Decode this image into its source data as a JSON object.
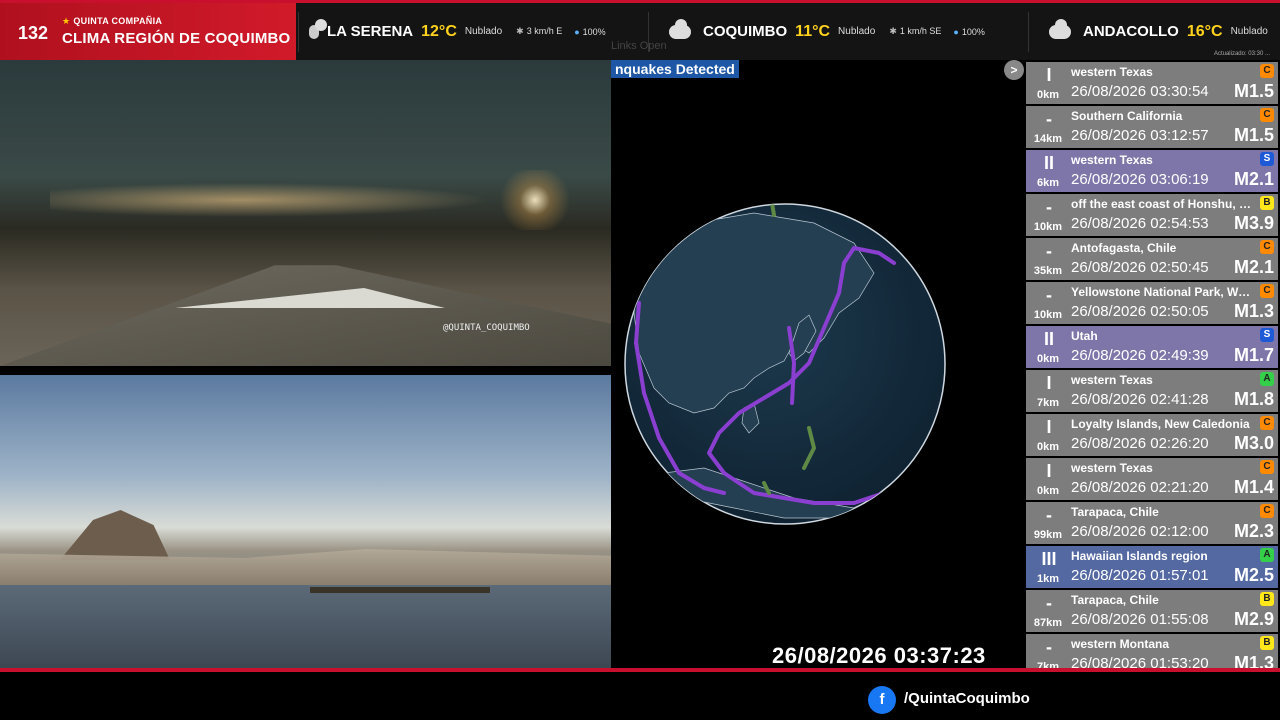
{
  "brand": {
    "channel_number": "132",
    "subtitle": "QUINTA COMPAÑIA",
    "title": "CLIMA REGIÓN DE COQUIMBO"
  },
  "weather": [
    {
      "city": "LA SERENA",
      "temp": "12°C",
      "condition": "Nublado",
      "wind": "3 km/h E",
      "humidity": "100%"
    },
    {
      "city": "COQUIMBO",
      "temp": "11°C",
      "condition": "Nublado",
      "wind": "1 km/h SE",
      "humidity": "100%"
    },
    {
      "city": "ANDACOLLO",
      "temp": "16°C",
      "condition": "Nublado"
    }
  ],
  "updated_label": "Actualizado: 03:30 ...",
  "cameras": {
    "top_watermark": "@QUINTA_COQUIMBO"
  },
  "globe_panel": {
    "ghost_links": "Links  Open",
    "banner": "nquakes Detected",
    "next_label": ">",
    "clock": "26/08/2026 03:37:23"
  },
  "quakes": [
    {
      "intensity": "I",
      "depth": "0km",
      "location": "western Texas",
      "time": "26/08/2026 03:30:54",
      "mag": "M1.5",
      "badge": "C",
      "style": "normal"
    },
    {
      "intensity": "-",
      "depth": "14km",
      "location": "Southern California",
      "time": "26/08/2026 03:12:57",
      "mag": "M1.5",
      "badge": "C",
      "style": "normal"
    },
    {
      "intensity": "II",
      "depth": "6km",
      "location": "western Texas",
      "time": "26/08/2026 03:06:19",
      "mag": "M2.1",
      "badge": "S",
      "style": "s"
    },
    {
      "intensity": "-",
      "depth": "10km",
      "location": "off the east coast of Honshu, Japan",
      "time": "26/08/2026 02:54:53",
      "mag": "M3.9",
      "badge": "B",
      "style": "normal"
    },
    {
      "intensity": "-",
      "depth": "35km",
      "location": "Antofagasta, Chile",
      "time": "26/08/2026 02:50:45",
      "mag": "M2.1",
      "badge": "C",
      "style": "normal"
    },
    {
      "intensity": "-",
      "depth": "10km",
      "location": "Yellowstone National Park, Wyoming",
      "time": "26/08/2026 02:50:05",
      "mag": "M1.3",
      "badge": "C",
      "style": "normal"
    },
    {
      "intensity": "II",
      "depth": "0km",
      "location": "Utah",
      "time": "26/08/2026 02:49:39",
      "mag": "M1.7",
      "badge": "S",
      "style": "s"
    },
    {
      "intensity": "I",
      "depth": "7km",
      "location": "western Texas",
      "time": "26/08/2026 02:41:28",
      "mag": "M1.8",
      "badge": "A",
      "style": "normal"
    },
    {
      "intensity": "I",
      "depth": "0km",
      "location": "Loyalty Islands, New Caledonia",
      "time": "26/08/2026 02:26:20",
      "mag": "M3.0",
      "badge": "C",
      "style": "normal"
    },
    {
      "intensity": "I",
      "depth": "0km",
      "location": "western Texas",
      "time": "26/08/2026 02:21:20",
      "mag": "M1.4",
      "badge": "C",
      "style": "normal"
    },
    {
      "intensity": "-",
      "depth": "99km",
      "location": "Tarapaca, Chile",
      "time": "26/08/2026 02:12:00",
      "mag": "M2.3",
      "badge": "C",
      "style": "normal"
    },
    {
      "intensity": "III",
      "depth": "1km",
      "location": "Hawaiian Islands region",
      "time": "26/08/2026 01:57:01",
      "mag": "M2.5",
      "badge": "A",
      "style": "hi"
    },
    {
      "intensity": "-",
      "depth": "87km",
      "location": "Tarapaca, Chile",
      "time": "26/08/2026 01:55:08",
      "mag": "M2.9",
      "badge": "B",
      "style": "normal"
    },
    {
      "intensity": "-",
      "depth": "7km",
      "location": "western Montana",
      "time": "26/08/2026 01:53:20",
      "mag": "M1.3",
      "badge": "B",
      "style": "normal"
    }
  ],
  "social": {
    "icon": "facebook-icon",
    "letter": "f",
    "handle": "/QuintaCoquimbo"
  },
  "colors": {
    "brand_red": "#c8102e",
    "temp_yellow": "#ffd21e",
    "banner_blue": "#1d57a6",
    "plate_purple": "#8a3fd0"
  }
}
